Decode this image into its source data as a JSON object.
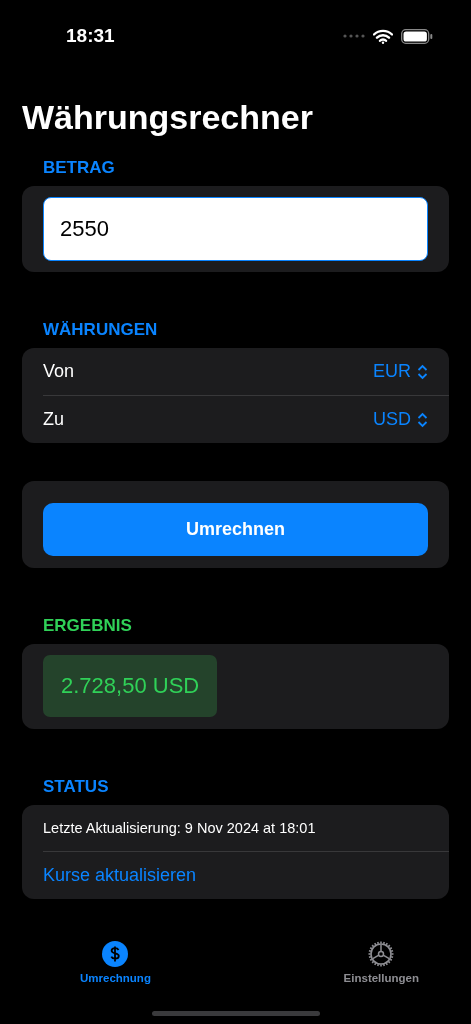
{
  "status_bar": {
    "time": "18:31"
  },
  "title": "Währungsrechner",
  "sections": [
    {
      "kind": "input",
      "header": "BETRAG",
      "color": "#0a84ff",
      "value": "2550"
    },
    {
      "kind": "pickers",
      "header": "WÄHRUNGEN",
      "color": "#0a84ff",
      "rows": [
        {
          "label": "Von",
          "value": "EUR"
        },
        {
          "label": "Zu",
          "value": "USD"
        }
      ]
    },
    {
      "kind": "button",
      "label": "Umrechnen"
    },
    {
      "kind": "result",
      "header": "ERGEBNIS",
      "color": "#30d158",
      "value": "2.728,50 USD"
    },
    {
      "kind": "status",
      "header": "STATUS",
      "color": "#0a84ff",
      "text": "Letzte Aktualisierung: 9 Nov 2024 at 18:01",
      "link": "Kurse aktualisieren"
    }
  ],
  "tabs": [
    {
      "label": "Umrechnung",
      "kind": "dollar",
      "selected": true
    },
    {
      "label": "Einstellungen",
      "kind": "gear",
      "selected": false
    }
  ]
}
